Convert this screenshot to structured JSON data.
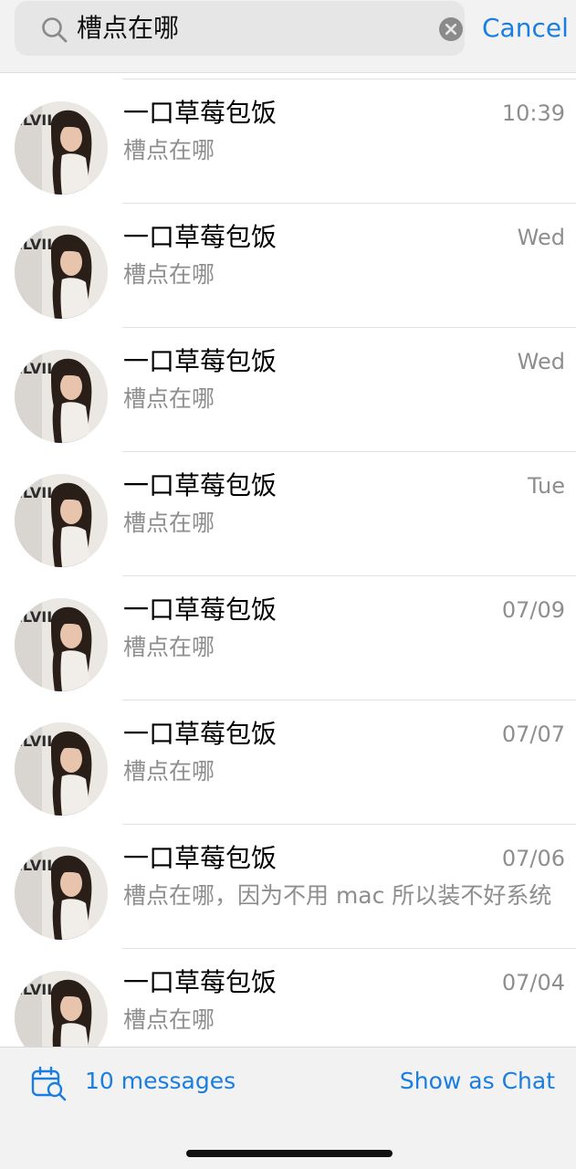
{
  "search": {
    "query": "槽点在哪",
    "cancel_label": "Cancel"
  },
  "results": [
    {
      "name": "一口草莓包饭",
      "time": "10:39",
      "snippet": "槽点在哪"
    },
    {
      "name": "一口草莓包饭",
      "time": "Wed",
      "snippet": "槽点在哪"
    },
    {
      "name": "一口草莓包饭",
      "time": "Wed",
      "snippet": "槽点在哪"
    },
    {
      "name": "一口草莓包饭",
      "time": "Tue",
      "snippet": "槽点在哪"
    },
    {
      "name": "一口草莓包饭",
      "time": "07/09",
      "snippet": "槽点在哪"
    },
    {
      "name": "一口草莓包饭",
      "time": "07/07",
      "snippet": "槽点在哪"
    },
    {
      "name": "一口草莓包饭",
      "time": "07/06",
      "snippet": "槽点在哪，因为不用 mac 所以装不好系统"
    },
    {
      "name": "一口草莓包饭",
      "time": "07/04",
      "snippet": "槽点在哪"
    }
  ],
  "bottom_bar": {
    "message_count": "10 messages",
    "show_as_chat_label": "Show as Chat"
  },
  "colors": {
    "accent": "#1a7ee0",
    "secondary_text": "#8e8e8e",
    "header_bg": "#f2f2f2"
  },
  "icons": {
    "search": "search-icon",
    "clear": "clear-icon",
    "calendar_search": "calendar-search-icon",
    "avatar": "avatar"
  }
}
